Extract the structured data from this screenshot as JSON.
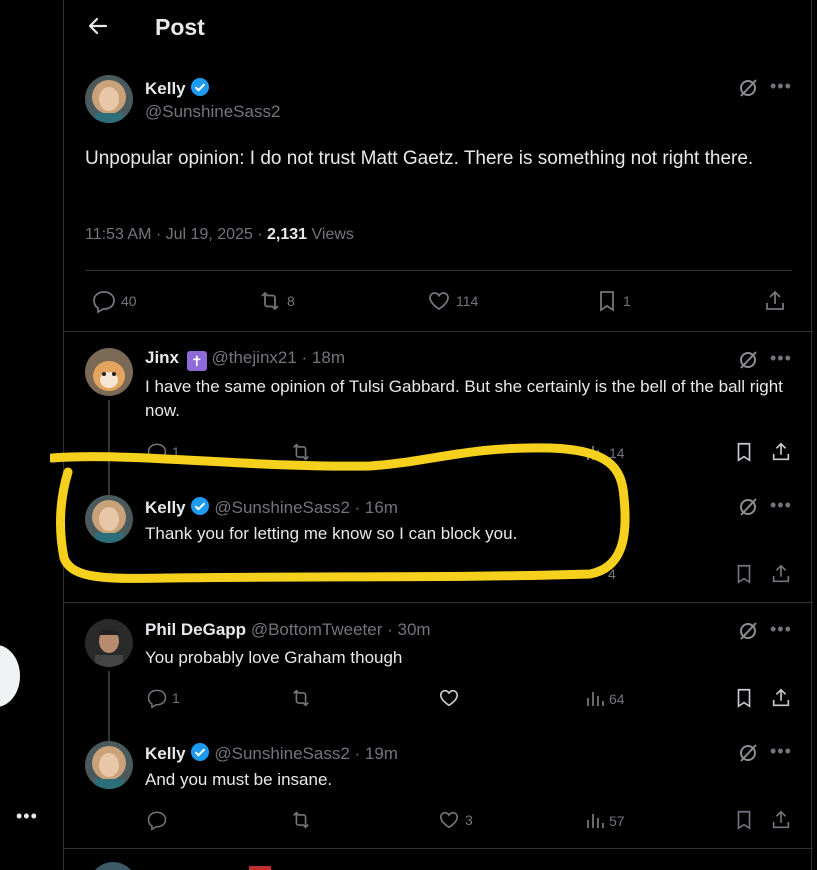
{
  "header": {
    "title": "Post"
  },
  "main_tweet": {
    "name": "Kelly",
    "handle": "@SunshineSass2",
    "text": "Unpopular opinion: I do not trust Matt Gaetz. There is something not right there.",
    "time": "11:53 AM · Jul 19, 2025 · ",
    "views_count": "2,131",
    "views_label": " Views",
    "replies": "40",
    "reposts": "8",
    "likes": "114",
    "bookmarks": "1"
  },
  "replies": [
    {
      "name": "Jinx",
      "badge": "✝",
      "handle": "@thejinx21 · 18m",
      "text": "I have the same opinion of Tulsi Gabbard. But she certainly is the bell of the ball right now.",
      "replies": "1",
      "views": "14"
    },
    {
      "name": "Kelly",
      "handle": "@SunshineSass2 · 16m",
      "text": "Thank you for letting me know so I can block you.",
      "views": "4"
    },
    {
      "name": "Phil DeGapp",
      "handle": "@BottomTweeter · 30m",
      "text": "You probably love Graham though",
      "replies": "1",
      "views": "64"
    },
    {
      "name": "Kelly",
      "handle": "@SunshineSass2 · 19m",
      "text": "And you must be insane.",
      "likes": "3",
      "views": "57"
    }
  ],
  "colors": {
    "background": "#000000",
    "text": "#e7e9ea",
    "muted": "#71767b",
    "verified": "#1d9bf0",
    "highlight": "#f5d01c",
    "badge": "#8e6bd8"
  }
}
